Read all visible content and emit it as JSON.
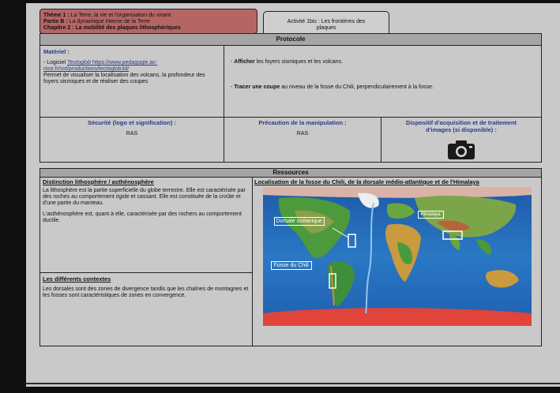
{
  "header": {
    "theme_label": "Thème 1 :",
    "theme_text": "La Terre, la vie et l'organisation du vivant",
    "partie_label": "Partie B :",
    "partie_text": "La dynamique interne de la Terre",
    "chapitre_text": "Chapitre 2 : La mobilité des plaques lithosphériques",
    "activity_line1": "Activité 1bis : Les frontières des",
    "activity_line2": "plaques"
  },
  "protocole": {
    "title": "Protocole",
    "materiel_label": "Matériel :",
    "software_prefix": "- Logiciel ",
    "software_name": "Tectoglob",
    "software_url": " https://www.pedagogie.ac-nice.fr/svt/productions/tectoglob3d/",
    "software_desc": "Permet de visualiser la localisation des volcans, la profondeur des foyers sismiques et de réaliser des coupes",
    "action1_bold": "Afficher",
    "action1_rest": " les foyers sismiques et les volcans.",
    "action2_bold": "Tracer une coupe",
    "action2_rest": " au niveau de la fosse du Chili, perpendiculairement à la fosse.",
    "securite_label": "Sécurité (logo et signification) :",
    "securite_value": "RAS",
    "precaution_label": "Précaution de la manipulation :",
    "precaution_value": "RAS",
    "dispositif_label": "Dispositif d'acquisition et de traitement d'images (si disponible) :",
    "camera_icon": "camera-icon"
  },
  "ressources": {
    "title": "Ressources",
    "section1_title": "Distinction lithosphère / asthénosphère",
    "section1_p1": "La lithosphère est la partie superficielle du globe terrestre. Elle est caractérisée par des roches au comportement rigide et cassant. Elle est constituée de la croûte et d'une partie du manteau.",
    "section1_p2": "L'asthénosphère est, quant à elle, caractérisée par des rochers au comportement ductile.",
    "section2_title": "Les différents contextes",
    "section2_p1": "Les dorsales sont des zones de divergence tandis que les chaînes de montagnes et les fosses sont caractéristiques de zones en convergence.",
    "map_title": "Localisation de la fosse du Chili, de la dorsale médio-atlantique et de l'Himalaya",
    "map_label_dorsale": "Dorsale océanique",
    "map_label_fosse": "Fosse du Chili",
    "map_label_himalaya": "Himalaya"
  },
  "colors": {
    "theme_bg": "#b66565",
    "header_bg": "#a5a5a5",
    "blue_titles": "#2b3a8a"
  }
}
